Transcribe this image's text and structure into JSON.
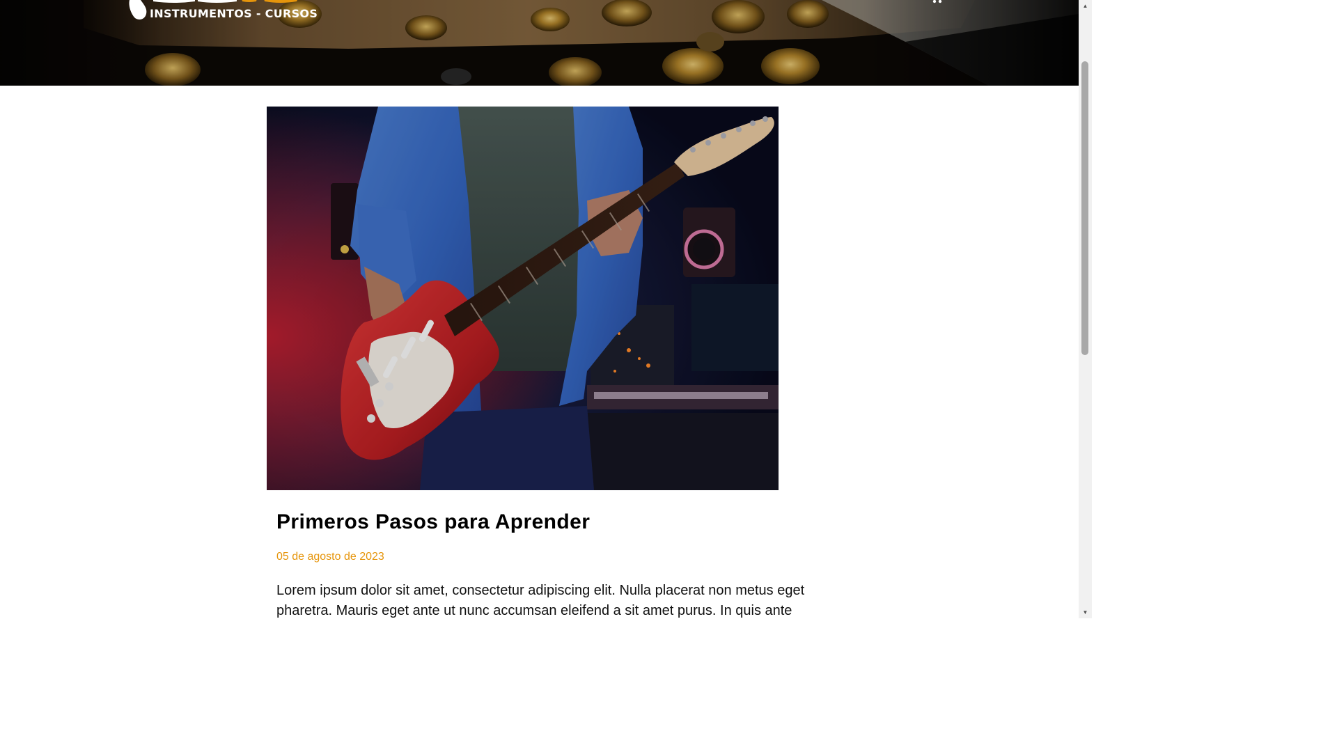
{
  "header": {
    "logo_subtitle": "INSTRUMENTOS - CURSOS",
    "brand_colors": {
      "white": "#ffffff",
      "accent": "#e6950b"
    },
    "cart_icon": "cart-icon"
  },
  "article": {
    "hero_image": "guitarist-studio-photo",
    "title": "Primeros Pasos para Aprender",
    "date": "05 de agosto de 2023",
    "body": "Lorem ipsum dolor sit amet, consectetur adipiscing elit. Nulla placerat non metus eget pharetra. Mauris eget ante ut nunc accumsan eleifend a sit amet purus. In quis ante"
  },
  "colors": {
    "date": "#e6950b",
    "title": "#000000",
    "text": "#111111"
  }
}
